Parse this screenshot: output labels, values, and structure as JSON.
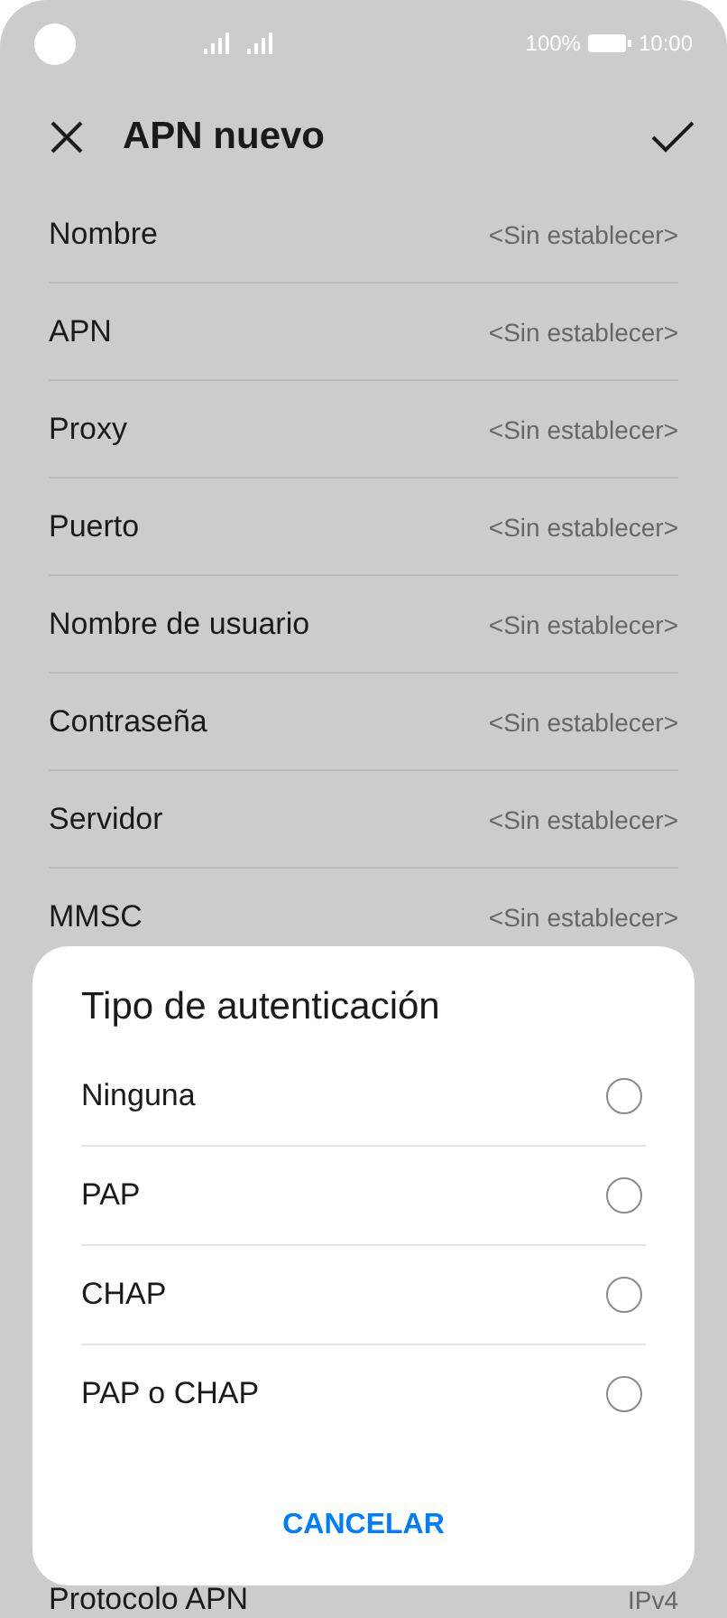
{
  "status_bar": {
    "battery": "100%",
    "time": "10:00"
  },
  "header": {
    "title": "APN nuevo"
  },
  "settings": [
    {
      "label": "Nombre",
      "value": "<Sin establecer>"
    },
    {
      "label": "APN",
      "value": "<Sin establecer>"
    },
    {
      "label": "Proxy",
      "value": "<Sin establecer>"
    },
    {
      "label": "Puerto",
      "value": "<Sin establecer>"
    },
    {
      "label": "Nombre de usuario",
      "value": "<Sin establecer>"
    },
    {
      "label": "Contraseña",
      "value": "<Sin establecer>"
    },
    {
      "label": "Servidor",
      "value": "<Sin establecer>"
    },
    {
      "label": "MMSC",
      "value": "<Sin establecer>"
    }
  ],
  "bottom_setting": {
    "label": "Protocolo APN",
    "value": "IPv4"
  },
  "dialog": {
    "title": "Tipo de autenticación",
    "options": [
      {
        "label": "Ninguna",
        "selected": false
      },
      {
        "label": "PAP",
        "selected": false
      },
      {
        "label": "CHAP",
        "selected": false
      },
      {
        "label": "PAP o CHAP",
        "selected": false
      }
    ],
    "cancel": "CANCELAR"
  }
}
